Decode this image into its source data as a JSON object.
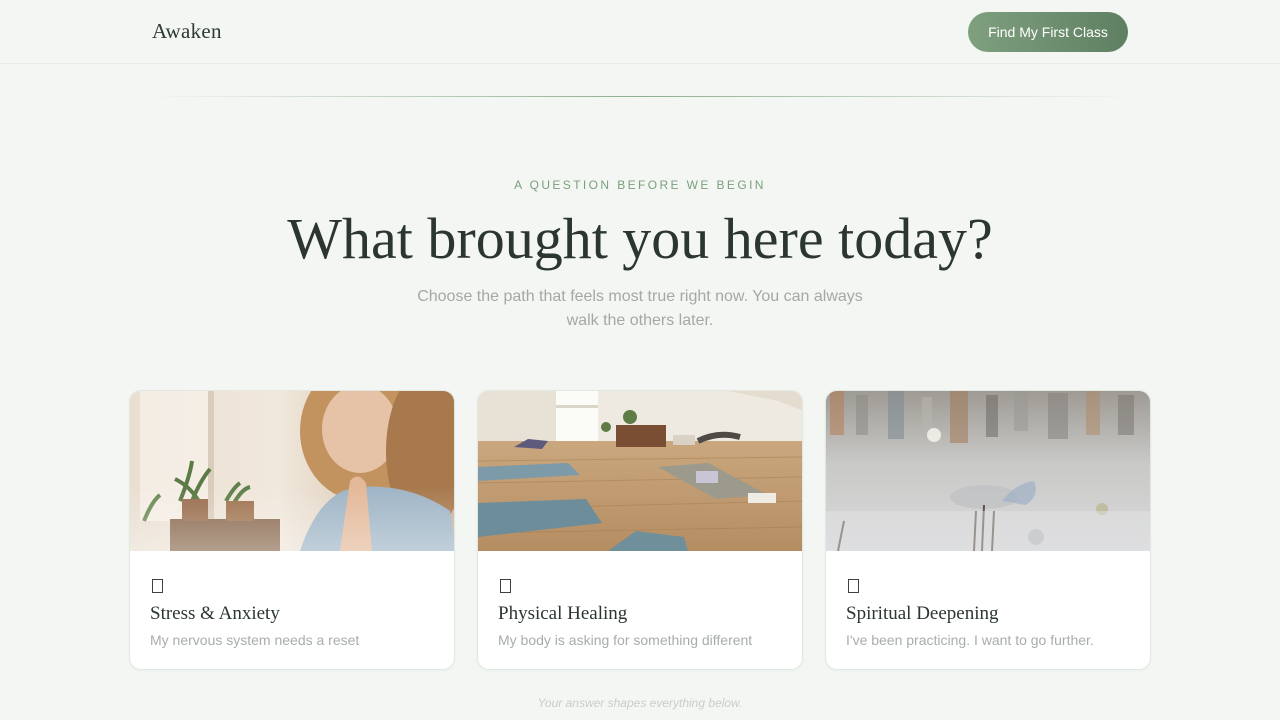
{
  "header": {
    "brand": "Awaken",
    "cta_label": "Find My First Class"
  },
  "intro": {
    "eyebrow": "A QUESTION BEFORE WE BEGIN",
    "headline": "What brought you here today?",
    "subtitle": "Choose the path that feels most true right now. You can always walk the others later."
  },
  "paths": [
    {
      "icon": "checkbox-icon",
      "title": "Stress & Anxiety",
      "description": "My nervous system needs a reset",
      "image": "woman-meditating-photo"
    },
    {
      "icon": "checkbox-icon",
      "title": "Physical Healing",
      "description": "My body is asking for something different",
      "image": "yoga-studio-photo"
    },
    {
      "icon": "checkbox-icon",
      "title": "Spiritual Deepening",
      "description": "I've been practicing. I want to go further.",
      "image": "incense-altar-photo"
    }
  ],
  "footnote": "Your answer shapes everything below.",
  "colors": {
    "background": "#f3f6f2",
    "accent": "#6f8f70",
    "heading": "#2b3630",
    "muted": "#a2aaa3"
  }
}
